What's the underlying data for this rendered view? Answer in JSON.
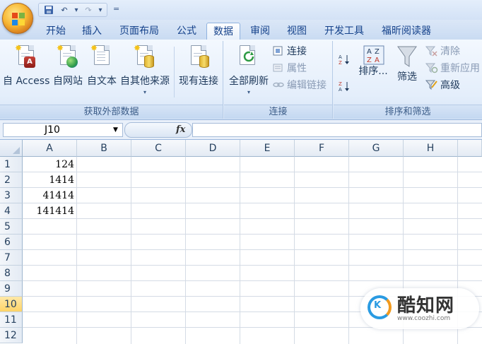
{
  "qat": {
    "save_icon": "save-icon",
    "undo_icon": "undo-icon",
    "redo_icon": "redo-icon",
    "customize_glyph": "="
  },
  "tabs": [
    {
      "label": "开始"
    },
    {
      "label": "插入"
    },
    {
      "label": "页面布局"
    },
    {
      "label": "公式"
    },
    {
      "label": "数据"
    },
    {
      "label": "审阅"
    },
    {
      "label": "视图"
    },
    {
      "label": "开发工具"
    },
    {
      "label": "福昕阅读器"
    }
  ],
  "active_tab": "数据",
  "ribbon": {
    "external": {
      "label": "获取外部数据",
      "access": "自 Access",
      "web": "自网站",
      "text": "自文本",
      "other": "自其他来源",
      "existing": "现有连接"
    },
    "connections": {
      "label": "连接",
      "refresh_all": "全部刷新",
      "connections": "连接",
      "properties": "属性",
      "edit_links": "编辑链接"
    },
    "sort_filter": {
      "label": "排序和筛选",
      "sort_az": "A→Z",
      "sort_za": "Z→A",
      "sort": "排序...",
      "filter": "筛选",
      "clear": "清除",
      "reapply": "重新应用",
      "advanced": "高级"
    }
  },
  "formula_bar": {
    "name_box": "J10",
    "fx_label": "fx",
    "formula": ""
  },
  "grid": {
    "columns": [
      "A",
      "B",
      "C",
      "D",
      "E",
      "F",
      "G",
      "H"
    ],
    "rows": [
      "1",
      "2",
      "3",
      "4",
      "5",
      "6",
      "7",
      "8",
      "9",
      "10",
      "11",
      "12"
    ],
    "active_row": "10",
    "cells": {
      "A1": "124",
      "A2": "1414",
      "A3": "41414",
      "A4": "141414"
    }
  },
  "watermark": {
    "title": "酷知网",
    "url": "www.coozhi.com",
    "logo_text": "K"
  },
  "colors": {
    "accent": "#15428b",
    "ribbon_bg": "#e4eefb",
    "active_row": "#ffd467"
  }
}
